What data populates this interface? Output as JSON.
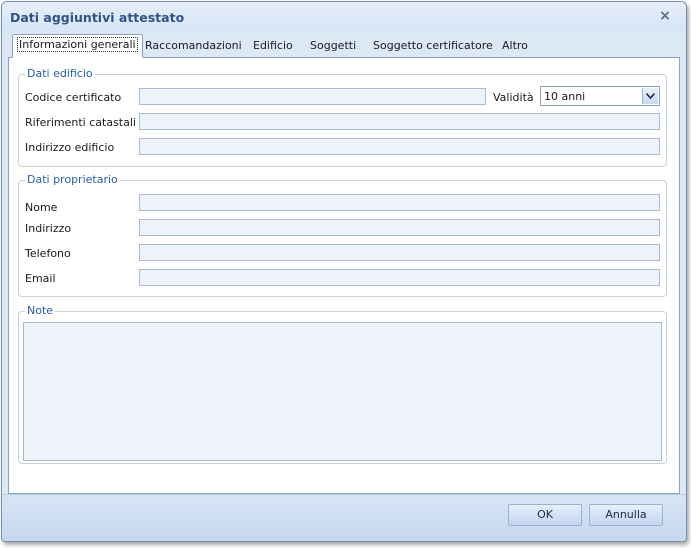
{
  "window": {
    "title": "Dati aggiuntivi attestato"
  },
  "tabs": [
    {
      "label": "Informazioni generali",
      "active": true
    },
    {
      "label": "Raccomandazioni",
      "active": false
    },
    {
      "label": "Edificio",
      "active": false
    },
    {
      "label": "Soggetti",
      "active": false
    },
    {
      "label": "Soggetto certificatore",
      "active": false
    },
    {
      "label": "Altro",
      "active": false
    }
  ],
  "dati_edificio": {
    "title": "Dati edificio",
    "codice_certificato": {
      "label": "Codice certificato",
      "value": ""
    },
    "validita": {
      "label": "Validità",
      "value": "10 anni"
    },
    "riferimenti_catastali": {
      "label": "Riferimenti catastali",
      "value": ""
    },
    "indirizzo_edificio": {
      "label": "Indirizzo edificio",
      "value": ""
    }
  },
  "dati_proprietario": {
    "title": "Dati proprietario",
    "nome": {
      "label": "Nome",
      "value": ""
    },
    "indirizzo": {
      "label": "Indirizzo",
      "value": ""
    },
    "telefono": {
      "label": "Telefono",
      "value": ""
    },
    "email": {
      "label": "Email",
      "value": ""
    }
  },
  "note": {
    "title": "Note",
    "value": ""
  },
  "buttons": {
    "ok": "OK",
    "annulla": "Annulla"
  },
  "icons": {
    "close": "close-icon",
    "dropdown": "chevron-down-icon"
  },
  "colors": {
    "accent": "#2a5ea8",
    "title": "#2f5385",
    "field_bg": "#eef3fa"
  }
}
